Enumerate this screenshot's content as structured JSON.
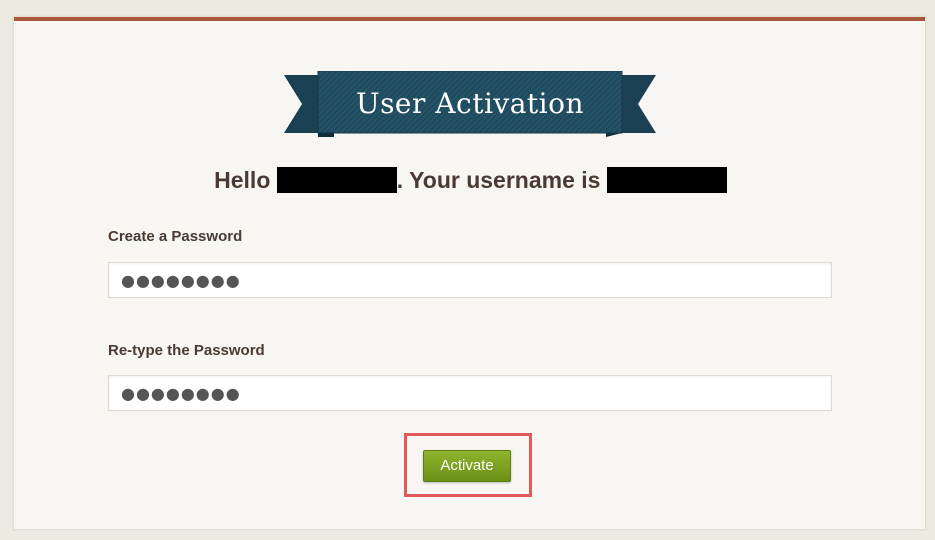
{
  "page": {
    "title": "User Activation"
  },
  "greeting": {
    "prefix": "Hello ",
    "middle": ". Your username is "
  },
  "form": {
    "password_label": "Create a Password",
    "password_value": "●●●●●●●●",
    "retype_label": "Re-type the Password",
    "retype_value": "●●●●●●●●",
    "submit_label": "Activate"
  },
  "colors": {
    "accent_bar": "#a9583b",
    "banner": "#1f4a5c",
    "button": "#7ea321",
    "highlight": "#e05a5a"
  },
  "icons": [
    "ribbon-banner"
  ]
}
